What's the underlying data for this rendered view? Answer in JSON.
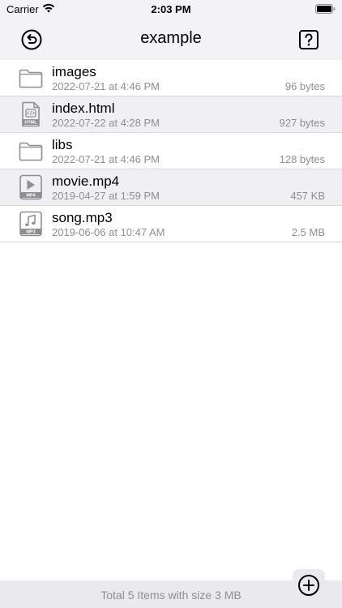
{
  "status_bar": {
    "carrier": "Carrier",
    "time": "2:03 PM",
    "icons": [
      "wifi-icon",
      "battery-icon"
    ]
  },
  "nav": {
    "title": "example",
    "left_icon": "undo-circle-icon",
    "right_icon": "help-question-icon"
  },
  "files": [
    {
      "name": "images",
      "date": "2022-07-21 at 4:46 PM",
      "size": "96 bytes",
      "icon": "folder-icon"
    },
    {
      "name": "index.html",
      "date": "2022-07-22 at 4:28 PM",
      "size": "927 bytes",
      "icon": "html-file-icon",
      "badge": "HTML"
    },
    {
      "name": "libs",
      "date": "2022-07-21 at 4:46 PM",
      "size": "128 bytes",
      "icon": "folder-icon"
    },
    {
      "name": "movie.mp4",
      "date": "2019-04-27 at 1:59 PM",
      "size": "457 KB",
      "icon": "video-file-icon",
      "badge": "MP4"
    },
    {
      "name": "song.mp3",
      "date": "2019-06-06 at 10:47 AM",
      "size": "2.5 MB",
      "icon": "audio-file-icon",
      "badge": "MP3"
    }
  ],
  "footer": {
    "summary": "Total 5 Items with size 3 MB",
    "add_icon": "add-circle-icon"
  },
  "colors": {
    "bar_background": "#f2f2f7",
    "selected_row": "#efeff4",
    "secondary_text": "#8e8e93",
    "icon_gray": "#8e8e93"
  }
}
